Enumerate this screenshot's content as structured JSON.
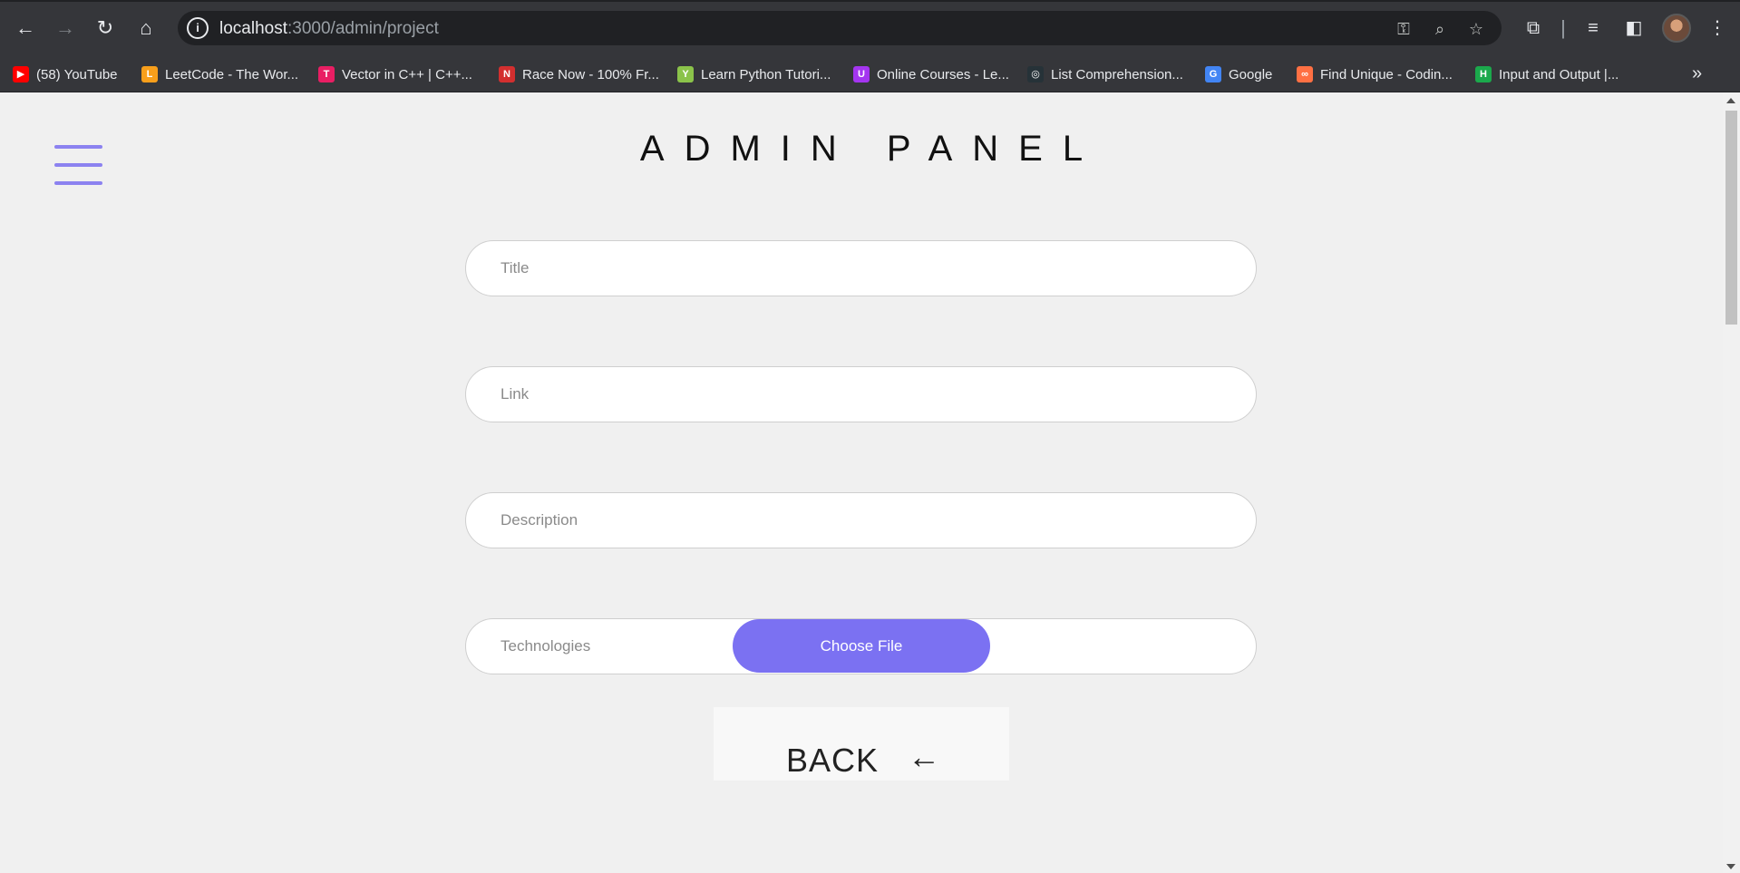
{
  "browser": {
    "url_host": "localhost",
    "url_path": ":3000/admin/project",
    "bookmarks": [
      {
        "label": "(58) YouTube",
        "icon": "youtube-icon",
        "color": "#ff0000"
      },
      {
        "label": "LeetCode - The Wor...",
        "icon": "leetcode-icon",
        "color": "#f89f1b"
      },
      {
        "label": "Vector in C++ | C++...",
        "icon": "site-icon",
        "color": "#e91e63"
      },
      {
        "label": "Race Now - 100% Fr...",
        "icon": "site-icon",
        "color": "#d32f2f"
      },
      {
        "label": "Learn Python Tutori...",
        "icon": "site-icon",
        "color": "#8bc34a"
      },
      {
        "label": "Online Courses - Le...",
        "icon": "udemy-icon",
        "color": "#a435f0"
      },
      {
        "label": "List Comprehension...",
        "icon": "site-icon",
        "color": "#263238"
      },
      {
        "label": "Google",
        "icon": "google-icon",
        "color": "#4285f4"
      },
      {
        "label": "Find Unique - Codin...",
        "icon": "site-icon",
        "color": "#ff7043"
      },
      {
        "label": "Input and Output |...",
        "icon": "hackerrank-icon",
        "color": "#1ba94c"
      }
    ]
  },
  "page": {
    "title": "ADMIN PANEL",
    "form": {
      "title_placeholder": "Title",
      "link_placeholder": "Link",
      "description_placeholder": "Description",
      "technologies_placeholder": "Technologies",
      "choose_file_label": "Choose File"
    },
    "back_label": "BACK",
    "back_arrow": "←"
  },
  "colors": {
    "accent": "#7b71f2",
    "hamburger": "#8c82f0",
    "background": "#f0f0f0"
  }
}
